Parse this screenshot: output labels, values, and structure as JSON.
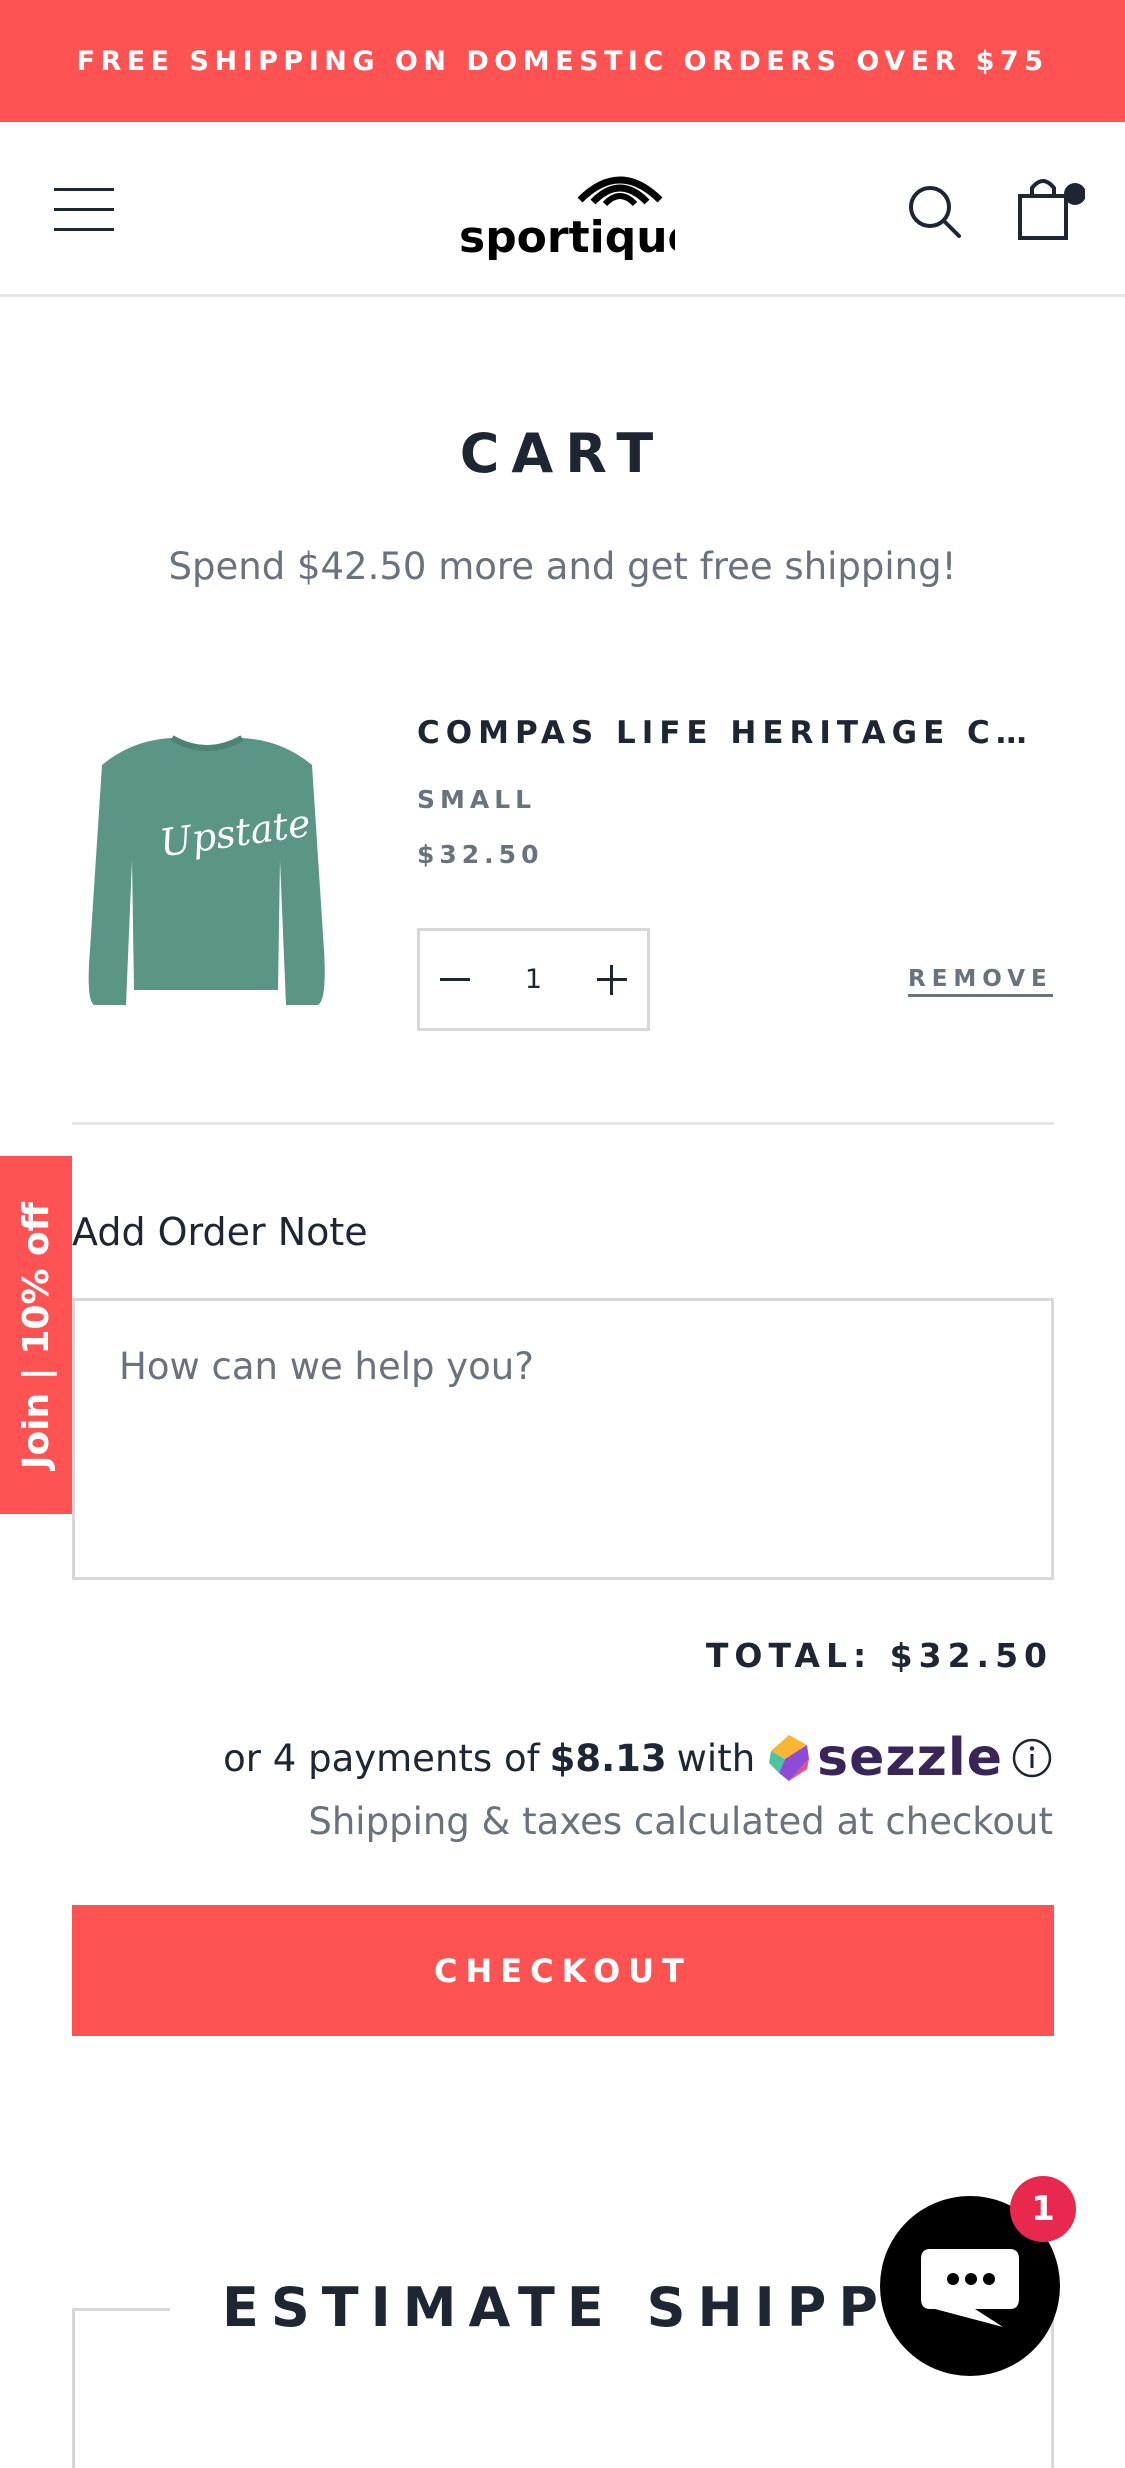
{
  "announcement": {
    "text": "FREE SHIPPING ON DOMESTIC ORDERS OVER $75"
  },
  "header": {
    "logo_text": "sportique",
    "icons": [
      "hamburger-menu-icon",
      "search-icon",
      "shopping-bag-icon"
    ]
  },
  "cart": {
    "title": "CART",
    "free_shipping_message": "Spend $42.50 more and get free shipping!",
    "items": [
      {
        "name": "COMPAS LIFE HERITAGE CREWNECK SWEATSHIRT",
        "variant": "SMALL",
        "price": "$32.50",
        "quantity": "1",
        "remove_label": "REMOVE",
        "image_text": "Upstate"
      }
    ]
  },
  "side_tab": {
    "label": "Join | 10% off"
  },
  "order_note": {
    "label": "Add Order Note",
    "placeholder": "How can we help you?"
  },
  "summary": {
    "total": "TOTAL: $32.50",
    "sezzle_prefix": "or 4 payments of",
    "sezzle_amount": "$8.13",
    "sezzle_with": "with",
    "sezzle_brand": "sezzle",
    "shipping_note": "Shipping & taxes calculated at checkout",
    "checkout_label": "CHECKOUT"
  },
  "estimate_shipping": {
    "title": "ESTIMATE SHIPPING"
  },
  "chat": {
    "badge_count": "1"
  },
  "colors": {
    "accent": "#ff5353",
    "text_dark": "#1e2633",
    "text_muted": "#6a727e",
    "sezzle_purple": "#392558",
    "badge": "#e8294d"
  }
}
